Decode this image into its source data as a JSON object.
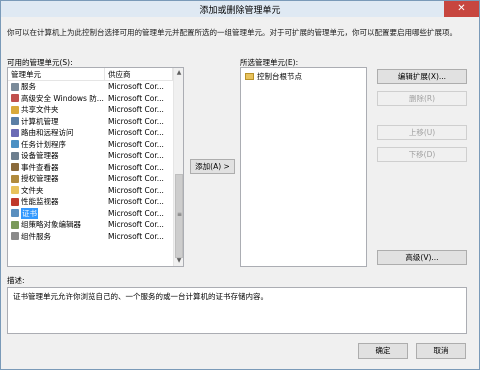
{
  "window": {
    "title": "添加或删除管理单元",
    "close_glyph": "✕"
  },
  "intro": "你可以在计算机上为此控制台选择可用的管理单元并配置所选的一组管理单元。对于可扩展的管理单元，你可以配置要启用哪些扩展项。",
  "available": {
    "label": "可用的管理单元(S):",
    "col_name": "管理单元",
    "col_vendor": "供应商",
    "items": [
      {
        "name": "服务",
        "vendor": "Microsoft Cor...",
        "icon": "gear-icon",
        "color": "#7a8a99"
      },
      {
        "name": "高级安全 Windows 防...",
        "vendor": "Microsoft Cor...",
        "icon": "firewall-icon",
        "color": "#c0504d"
      },
      {
        "name": "共享文件夹",
        "vendor": "Microsoft Cor...",
        "icon": "shared-folder-icon",
        "color": "#d9a93a"
      },
      {
        "name": "计算机管理",
        "vendor": "Microsoft Cor...",
        "icon": "computer-icon",
        "color": "#5b7fa6"
      },
      {
        "name": "路由和远程访问",
        "vendor": "Microsoft Cor...",
        "icon": "router-icon",
        "color": "#6b6bb5"
      },
      {
        "name": "任务计划程序",
        "vendor": "Microsoft Cor...",
        "icon": "clock-icon",
        "color": "#4a90c4"
      },
      {
        "name": "设备管理器",
        "vendor": "Microsoft Cor...",
        "icon": "device-icon",
        "color": "#6d7f8f"
      },
      {
        "name": "事件查看器",
        "vendor": "Microsoft Cor...",
        "icon": "event-log-icon",
        "color": "#8a6a3a"
      },
      {
        "name": "授权管理器",
        "vendor": "Microsoft Cor...",
        "icon": "authorization-icon",
        "color": "#b08a3c"
      },
      {
        "name": "文件夹",
        "vendor": "Microsoft Cor...",
        "icon": "folder-icon",
        "color": "#e8c25c"
      },
      {
        "name": "性能监视器",
        "vendor": "Microsoft Cor...",
        "icon": "performance-icon",
        "color": "#c0392b"
      },
      {
        "name": "证书",
        "vendor": "Microsoft Cor...",
        "icon": "certificate-icon",
        "color": "#5a8fbf"
      },
      {
        "name": "组策略对象编辑器",
        "vendor": "Microsoft Cor...",
        "icon": "policy-icon",
        "color": "#7a9a5a"
      },
      {
        "name": "组件服务",
        "vendor": "Microsoft Cor...",
        "icon": "component-icon",
        "color": "#8a8a8a"
      }
    ],
    "selected_index": 11
  },
  "add_button": "添加(A) >",
  "selected": {
    "label": "所选管理单元(E):",
    "root_item": "控制台根节点"
  },
  "side_buttons": {
    "edit_ext": "编辑扩展(X)...",
    "remove": "删除(R)",
    "move_up": "上移(U)",
    "move_down": "下移(D)",
    "advanced": "高级(V)..."
  },
  "description": {
    "label": "描述:",
    "text": "证书管理单元允许你浏览自己的、一个服务的或一台计算机的证书存储内容。"
  },
  "footer": {
    "ok": "确定",
    "cancel": "取消"
  }
}
